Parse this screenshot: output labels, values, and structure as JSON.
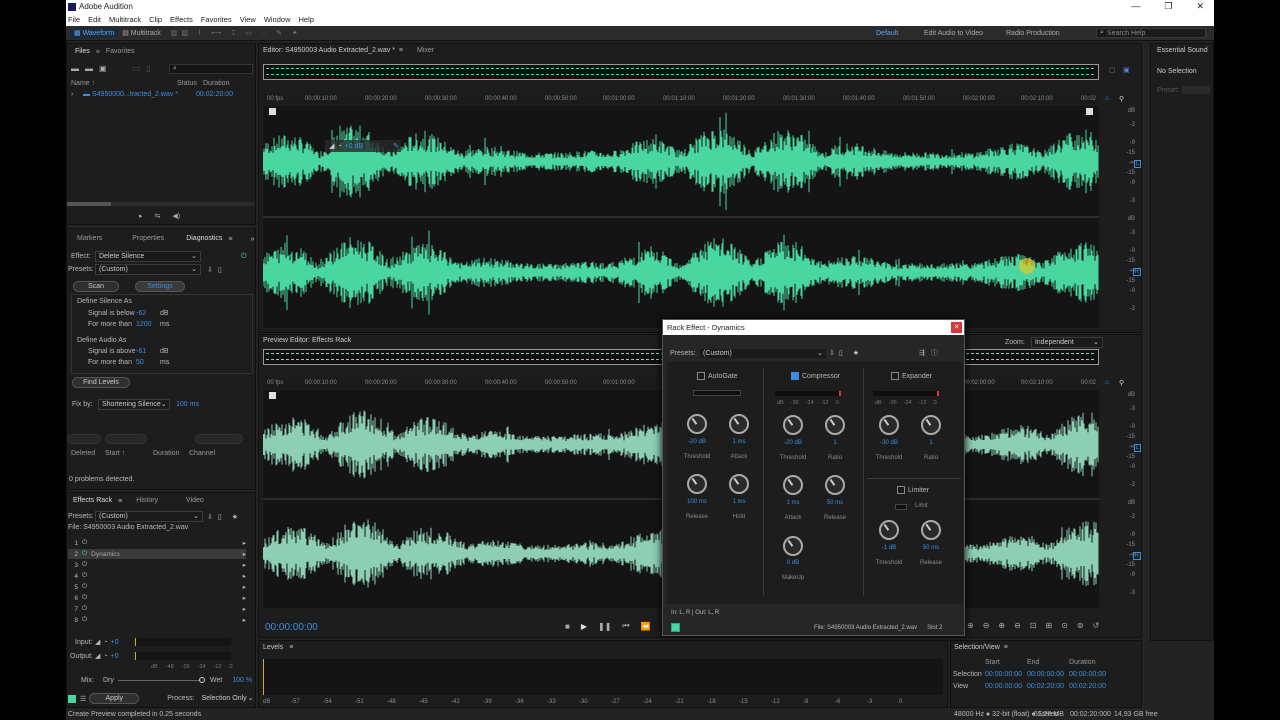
{
  "window": {
    "app_title": "Adobe Audition"
  },
  "menu": [
    "File",
    "Edit",
    "Multitrack",
    "Clip",
    "Effects",
    "Favorites",
    "View",
    "Window",
    "Help"
  ],
  "toolbar": {
    "waveform": "Waveform",
    "multitrack": "Multitrack",
    "workspaces": [
      "Default",
      "Edit Audio to Video",
      "Radio Production"
    ],
    "search_placeholder": "Search Help"
  },
  "files_panel": {
    "tabs": [
      "Files",
      "Favorites"
    ],
    "col_name": "Name ↑",
    "col_status": "Status",
    "col_duration": "Duration",
    "file_name": "S4950000...tracted_2.wav *",
    "file_duration": "00:02:20:00"
  },
  "diagnostics": {
    "tabs": [
      "Markers",
      "Properties",
      "Diagnostics"
    ],
    "effect_label": "Effect:",
    "effect_value": "Delete Silence",
    "presets_label": "Presets:",
    "presets_value": "(Custom)",
    "scan": "Scan",
    "settings": "Settings",
    "silence_title": "Define Silence As",
    "signal_below": "Signal is below",
    "below_val": "-62",
    "below_unit": "dB",
    "more_than": "For more than",
    "more_val1": "1200",
    "more_unit": "ms",
    "audio_title": "Define Audio As",
    "signal_above": "Signal is above",
    "above_val": "-61",
    "above_unit": "dB",
    "more_val2": "50",
    "find_levels": "Find Levels",
    "fix_by": "Fix by:",
    "fix_value": "Shortening Silence",
    "fix_ms": "100 ms",
    "col_deleted": "Deleted",
    "col_start": "Start ↑",
    "col_duration": "Duration",
    "col_channel": "Channel",
    "problems": "0 problems detected."
  },
  "effects_rack": {
    "tabs": [
      "Effects Rack",
      "History",
      "Video"
    ],
    "presets_label": "Presets:",
    "presets_value": "(Custom)",
    "file_label": "File: S4950003 Audio Extracted_2.wav",
    "slots": [
      "1",
      "2",
      "3",
      "4",
      "5",
      "6",
      "7",
      "8"
    ],
    "slot2_name": "Dynamics",
    "input": "Input:",
    "input_val": "+0",
    "output": "Output:",
    "output_val": "+0",
    "meter_ticks": [
      "dB",
      "-48",
      "-36",
      "-24",
      "-12",
      "0"
    ],
    "mix": "Mix:",
    "dry": "Dry",
    "wet": "Wet",
    "wet_val": "100 %",
    "apply": "Apply",
    "process": "Process:",
    "process_value": "Selection Only"
  },
  "status_bar": {
    "message": "Create Preview completed in 0,25 seconds",
    "format": "48000 Hz ● 32-bit (float) ● Stereo",
    "size": "51,28 MB",
    "duration": "00:02:20:000",
    "free": "14,93 GB free"
  },
  "editor": {
    "tab": "Editor: S4950003 Audio Extracted_2.wav *",
    "mixer": "Mixer",
    "ruler_ticks": [
      "00 fps",
      "00:00:10:00",
      "00:00:20:00",
      "00:00:30:00",
      "00:00:40:00",
      "00:00:50:00",
      "00:01:00:00",
      "00:01:10:00",
      "00:01:20:00",
      "00:01:30:00",
      "00:01:40:00",
      "00:01:50:00",
      "00:02:00:00",
      "00:02:10:00",
      "00:02"
    ],
    "hud_db": "+0 dB",
    "db_scale": [
      "dB",
      "-3",
      "-9",
      "-15",
      "-∞",
      "-15",
      "-9",
      "-3"
    ],
    "ch_l": "L",
    "ch_r": "R"
  },
  "preview_editor": {
    "title": "Preview Editor: Effects Rack",
    "zoom_label": "Zoom:",
    "zoom_value": "Independent"
  },
  "transport": {
    "time": "00:00:00:00"
  },
  "levels": {
    "title": "Levels",
    "ticks": [
      "dB",
      "-57",
      "-54",
      "-51",
      "-48",
      "-45",
      "-42",
      "-39",
      "-36",
      "-33",
      "-30",
      "-27",
      "-24",
      "-21",
      "-18",
      "-15",
      "-12",
      "-9",
      "-6",
      "-3",
      "0"
    ]
  },
  "selection_view": {
    "title": "Selection/View",
    "start": "Start",
    "end": "End",
    "duration": "Duration",
    "selection": "Selection",
    "view": "View",
    "sel_start": "00:00:00:00",
    "sel_end": "00:00:00:00",
    "sel_dur": "00:00:00:00",
    "view_start": "00:00:00:00",
    "view_end": "00:02:20:00",
    "view_dur": "00:02:20:00"
  },
  "essential_sound": {
    "title": "Essential Sound",
    "no_selection": "No Selection",
    "preset": "Preset:"
  },
  "dialog": {
    "title": "Rack Effect - Dynamics",
    "presets_label": "Presets:",
    "presets_value": "(Custom)",
    "autogate": "AutoGate",
    "compressor": "Compressor",
    "expander": "Expander",
    "limiter": "Limiter",
    "meter_ticks": [
      "dB",
      "-36",
      "-24",
      "-12",
      "0"
    ],
    "gate_threshold": "-20 dB",
    "gate_attack": "1 ms",
    "gate_release": "100 ms",
    "gate_hold": "1 ms",
    "comp_threshold": "-20 dB",
    "comp_ratio": "1",
    "comp_attack": "1 ms",
    "comp_release": "50 ms",
    "comp_makeup": "0 dB",
    "exp_threshold": "-30 dB",
    "exp_ratio": "1",
    "lim_threshold": "-1 dB",
    "lim_release": "50 ms",
    "lbl_threshold": "Threshold",
    "lbl_attack": "Attack",
    "lbl_release": "Release",
    "lbl_hold": "Hold",
    "lbl_ratio": "Ratio",
    "lbl_makeup": "MakeUp",
    "lbl_limit": "Limit",
    "io": "In: L, R | Out: L, R",
    "file": "File: S4950003 Audio Extracted_2.wav",
    "slot": "Slot 2"
  },
  "colors": {
    "waveform": "#49d6a0",
    "preview_waveform": "#8ccfb4",
    "accent": "#3b8ee3",
    "close_red": "#d9343a"
  }
}
